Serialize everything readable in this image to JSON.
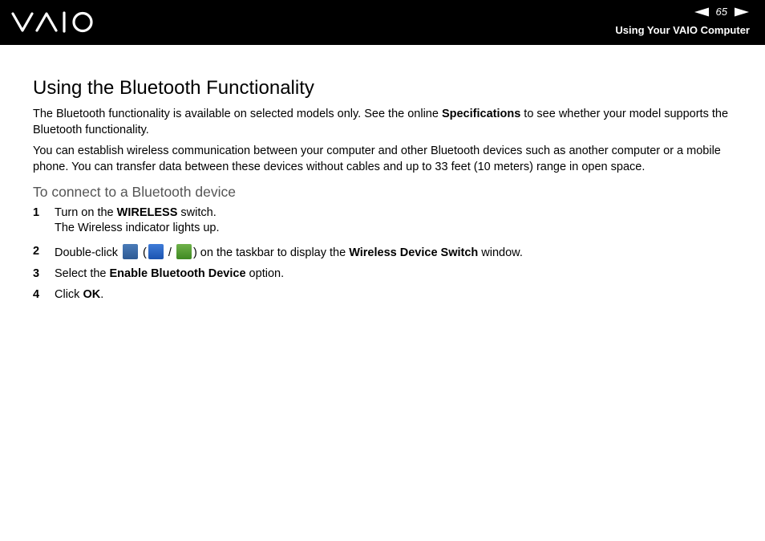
{
  "header": {
    "logo_text": "VAIO",
    "page_number": "65",
    "section_title": "Using Your VAIO Computer"
  },
  "main": {
    "title": "Using the Bluetooth Functionality",
    "para1_pre": "The Bluetooth functionality is available on selected models only. See the online ",
    "para1_bold": "Specifications",
    "para1_post": " to see whether your model supports the Bluetooth functionality.",
    "para2": "You can establish wireless communication between your computer and other Bluetooth devices such as another computer or a mobile phone. You can transfer data between these devices without cables and up to 33 feet (10 meters) range in open space.",
    "subheading": "To connect to a Bluetooth device",
    "steps": [
      {
        "num": "1",
        "pre": "Turn on the ",
        "bold": "WIRELESS",
        "post": " switch.",
        "line2": "The Wireless indicator lights up."
      },
      {
        "num": "2",
        "pre": "Double-click ",
        "paren_open": " (",
        "slash": " / ",
        "paren_close": ") on the taskbar to display the ",
        "bold": "Wireless Device Switch",
        "post": " window."
      },
      {
        "num": "3",
        "pre": "Select the ",
        "bold": "Enable Bluetooth Device",
        "post": " option."
      },
      {
        "num": "4",
        "pre": "Click ",
        "bold": "OK",
        "post": "."
      }
    ]
  }
}
